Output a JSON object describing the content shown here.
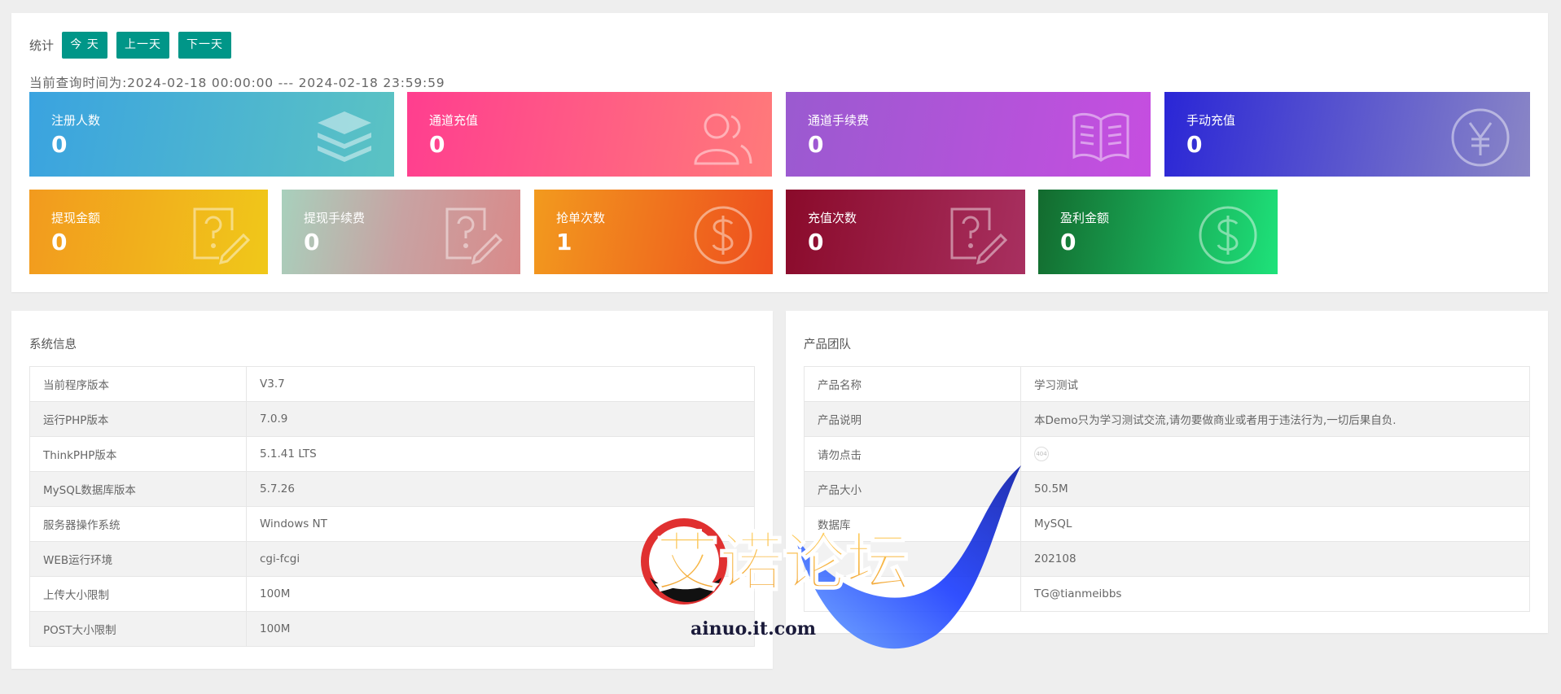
{
  "toolbar": {
    "label": "统计",
    "today": "今 天",
    "prev_day": "上一天",
    "next_day": "下一天"
  },
  "range_text": "当前查询时间为:2024-02-18 00:00:00 --- 2024-02-18 23:59:59",
  "cards": [
    {
      "title": "注册人数",
      "value": "0",
      "icon": "stack-icon"
    },
    {
      "title": "通道充值",
      "value": "0",
      "icon": "users-icon"
    },
    {
      "title": "通道手续费",
      "value": "0",
      "icon": "book-icon"
    },
    {
      "title": "手动充值",
      "value": "0",
      "icon": "yen-icon"
    },
    {
      "title": "提现金额",
      "value": "0",
      "icon": "question-edit-icon"
    },
    {
      "title": "提现手续费",
      "value": "0",
      "icon": "question-edit-icon"
    },
    {
      "title": "抢单次数",
      "value": "1",
      "icon": "dollar-icon"
    },
    {
      "title": "充值次数",
      "value": "0",
      "icon": "question-edit-icon"
    },
    {
      "title": "盈利金额",
      "value": "0",
      "icon": "dollar-icon"
    }
  ],
  "system": {
    "title": "系统信息",
    "rows": [
      {
        "k": "当前程序版本",
        "v": "V3.7"
      },
      {
        "k": "运行PHP版本",
        "v": "7.0.9"
      },
      {
        "k": "ThinkPHP版本",
        "v": "5.1.41 LTS"
      },
      {
        "k": "MySQL数据库版本",
        "v": "5.7.26"
      },
      {
        "k": "服务器操作系统",
        "v": "Windows NT"
      },
      {
        "k": "WEB运行环境",
        "v": "cgi-fcgi"
      },
      {
        "k": "上传大小限制",
        "v": "100M"
      },
      {
        "k": "POST大小限制",
        "v": "100M"
      }
    ]
  },
  "team": {
    "title": "产品团队",
    "rows": [
      {
        "k": "产品名称",
        "v": "学习测试"
      },
      {
        "k": "产品说明",
        "v": "本Demo只为学习测试交流,请勿要做商业或者用于违法行为,一切后果自负."
      },
      {
        "k": "请勿点击",
        "v": ""
      },
      {
        "k": "产品大小",
        "v": "50.5M"
      },
      {
        "k": "数据库",
        "v": "MySQL"
      },
      {
        "k": "",
        "v": "202108"
      },
      {
        "k": "",
        "v": "TG@tianmeibbs"
      }
    ]
  },
  "watermark": {
    "text": "艾诺论坛",
    "url": "ainuo.it.com"
  }
}
